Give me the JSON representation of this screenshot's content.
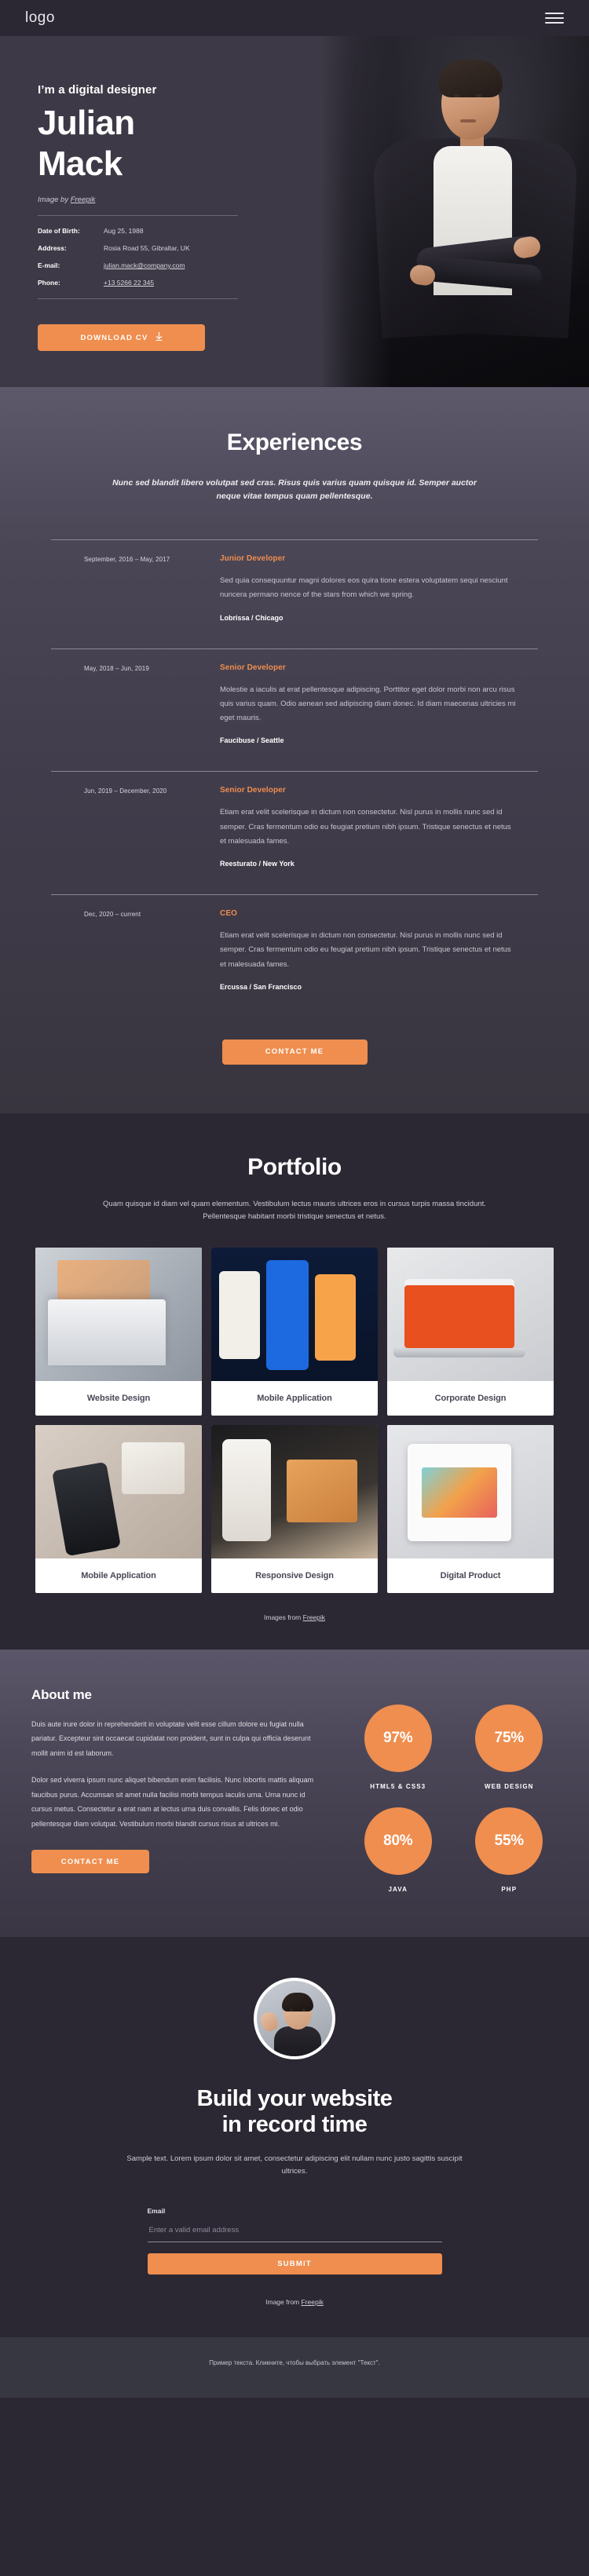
{
  "header": {
    "logo": "logo",
    "menu_icon": "hamburger-menu-icon"
  },
  "hero": {
    "kicker": "I’m a digital designer",
    "name_line1": "Julian",
    "name_line2": "Mack",
    "credit_prefix": "Image by ",
    "credit_link": "Freepik",
    "facts": [
      {
        "label": "Date of Birth:",
        "value": "Aug 25, 1988",
        "link": false
      },
      {
        "label": "Address:",
        "value": "Rosia Road 55, Gibraltar, UK",
        "link": false
      },
      {
        "label": "E-mail:",
        "value": "julian.mack@company.com",
        "link": true
      },
      {
        "label": "Phone:",
        "value": "+13 5266 22 345",
        "link": true
      }
    ],
    "cv_button": "DOWNLOAD CV",
    "cv_button_icon": "download-arrow-icon"
  },
  "experiences": {
    "title": "Experiences",
    "subtitle": "Nunc sed blandit libero volutpat sed cras. Risus quis varius quam quisque id. Semper auctor neque vitae tempus quam pellentesque.",
    "items": [
      {
        "date": "September, 2016 – May, 2017",
        "role": "Junior Developer",
        "desc": "Sed quia consequuntur magni dolores eos quira tione estera voluptatem sequi nesciunt nuncera permano nence of the stars from which we spring.",
        "company": "Lobrissa / Chicago"
      },
      {
        "date": "May, 2018 – Jun, 2019",
        "role": "Senior Developer",
        "desc": "Molestie a iaculis at erat pellentesque adipiscing. Porttitor eget dolor morbi non arcu risus quis varius quam. Odio aenean sed adipiscing diam donec. Id diam maecenas ultricies mi eget mauris.",
        "company": "Faucibuse / Seattle"
      },
      {
        "date": "Jun, 2019 – December, 2020",
        "role": "Senior Developer",
        "desc": "Etiam erat velit scelerisque in dictum non consectetur. Nisl purus in mollis nunc sed id semper. Cras fermentum odio eu feugiat pretium nibh ipsum. Tristique senectus et netus et malesuada fames.",
        "company": "Reesturato / New York"
      },
      {
        "date": "Dec, 2020 – current",
        "role": "CEO",
        "desc": "Etiam erat velit scelerisque in dictum non consectetur. Nisl purus in mollis nunc sed id semper. Cras fermentum odio eu feugiat pretium nibh ipsum. Tristique senectus et netus et malesuada fames.",
        "company": "Ercussa / San Francisco"
      }
    ],
    "contact_button": "CONTACT ME"
  },
  "portfolio": {
    "title": "Portfolio",
    "subtitle": "Quam quisque id diam vel quam elementum. Vestibulum lectus mauris ultrices eros in cursus turpis massa tincidunt. Pellentesque habitant morbi tristique senectus et netus.",
    "cards": [
      {
        "caption": "Website Design"
      },
      {
        "caption": "Mobile Application"
      },
      {
        "caption": "Corporate Design"
      },
      {
        "caption": "Mobile Application"
      },
      {
        "caption": "Responsive Design"
      },
      {
        "caption": "Digital Product"
      }
    ],
    "credit_prefix": "Images from ",
    "credit_link": "Freepik"
  },
  "about": {
    "title": "About me",
    "paragraph1": "Duis aute irure dolor in reprehenderit in voluptate velit esse cillum dolore eu fugiat nulla pariatur. Excepteur sint occaecat cupidatat non proident, sunt in culpa qui officia deserunt mollit anim id est laborum.",
    "paragraph2": "Dolor sed viverra ipsum nunc aliquet bibendum enim facilisis. Nunc lobortis mattis aliquam faucibus purus. Accumsan sit amet nulla facilisi morbi tempus iaculis urna. Urna nunc id cursus metus. Consectetur a erat nam at lectus urna duis convallis. Felis donec et odio pellentesque diam volutpat. Vestibulum morbi blandit cursus risus at ultrices mi.",
    "contact_button": "CONTACT ME",
    "skills": [
      {
        "value": "97%",
        "label": "HTML5 & CSS3"
      },
      {
        "value": "75%",
        "label": "WEB DESIGN"
      },
      {
        "value": "80%",
        "label": "JAVA"
      },
      {
        "value": "55%",
        "label": "PHP"
      }
    ]
  },
  "cta": {
    "avatar": "person-waving-avatar",
    "title_line1": "Build your website",
    "title_line2": "in record time",
    "subtitle": "Sample text. Lorem ipsum dolor sit amet, consectetur adipiscing elit nullam nunc justo sagittis suscipit ultrices.",
    "email_label": "Email",
    "email_placeholder": "Enter a valid email address",
    "email_value": "",
    "submit_button": "SUBMIT",
    "credit_prefix": "Image from ",
    "credit_link": "Freepik"
  },
  "footer": {
    "text": "Пример текста. Кликните, чтобы выбрать элемент \"Текст\"."
  },
  "colors": {
    "accent": "#ef8e4f",
    "dark_bg": "#2b2733",
    "panel_bg": "#3d3946",
    "footer_bg": "#373741"
  }
}
